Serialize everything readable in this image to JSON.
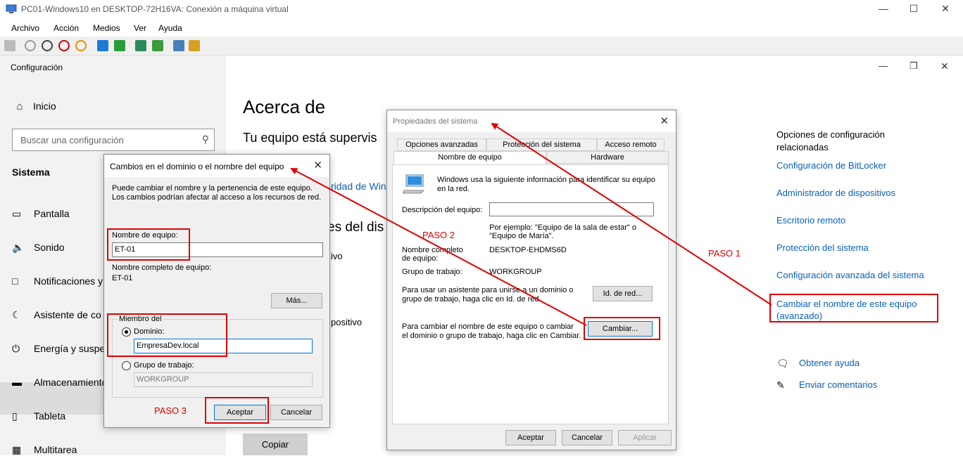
{
  "host": {
    "title": "PC01-Windows10 en DESKTOP-72H16VA: Conexión a máquina virtual",
    "menu": [
      "Archivo",
      "Acción",
      "Medios",
      "Ver",
      "Ayuda"
    ]
  },
  "settings": {
    "app_title": "Configuración",
    "home": "Inicio",
    "search_placeholder": "Buscar una configuración",
    "section": "Sistema",
    "nav": [
      "Pantalla",
      "Sonido",
      "Notificaciones y",
      "Asistente de co",
      "Energía y suspe",
      "Almacenamiento",
      "Tableta",
      "Multitarea"
    ],
    "main_title": "Acerca de",
    "main_sub": "Tu equipo está supervis",
    "partial_link": "ridad de Win",
    "partial_heading": "es del dis",
    "partial_text1": "ivo",
    "partial_text2": "positivo",
    "copy": "Copiar",
    "related_heading": "Opciones de configuración relacionadas",
    "related_links": [
      "Configuración de BitLocker",
      "Administrador de dispositivos",
      "Escritorio remoto",
      "Protección del sistema",
      "Configuración avanzada del sistema",
      "Cambiar el nombre de este equipo (avanzado)"
    ],
    "help": "Obtener ayuda",
    "feedback": "Enviar comentarios"
  },
  "sysprops": {
    "title": "Propiedades del sistema",
    "tabs_top": [
      "Opciones avanzadas",
      "Protección del sistema",
      "Acceso remoto"
    ],
    "tabs_bottom": [
      "Nombre de equipo",
      "Hardware"
    ],
    "intro": "Windows usa la siguiente información para identificar su equipo en la red.",
    "desc_label": "Descripción del equipo:",
    "example": "Por ejemplo: \"Equipo de la sala de estar\" o \"Equipo de María\".",
    "fullname_label": "Nombre completo de equipo:",
    "fullname_value": "DESKTOP-EHDMS6D",
    "workgroup_label": "Grupo de trabajo:",
    "workgroup_value": "WORKGROUP",
    "wizard_text": "Para usar un asistente para unirse a un dominio o grupo de trabajo, haga clic en Id. de red.",
    "netid_button": "Id. de red...",
    "change_text": "Para cambiar el nombre de este equipo o cambiar el dominio o grupo de trabajo, haga clic en Cambiar.",
    "change_button": "Cambiar...",
    "ok": "Aceptar",
    "cancel": "Cancelar",
    "apply": "Aplicar"
  },
  "change_dialog": {
    "title": "Cambios en el dominio o el nombre del equipo",
    "intro": "Puede cambiar el nombre y la pertenencia de este equipo. Los cambios podrían afectar al acceso a los recursos de red.",
    "name_label": "Nombre de equipo:",
    "name_value": "ET-01",
    "fullname_label": "Nombre completo de equipo:",
    "fullname_value": "ET-01",
    "more_button": "Más...",
    "member_of": "Miembro del",
    "domain_label": "Dominio:",
    "domain_value": "EmpresaDev.local",
    "workgroup_label": "Grupo de trabajo:",
    "workgroup_value": "WORKGROUP",
    "ok": "Aceptar",
    "cancel": "Cancelar"
  },
  "annotations": {
    "paso1": "PASO 1",
    "paso2": "PASO 2",
    "paso3": "PASO 3",
    "color": "#e00000"
  }
}
